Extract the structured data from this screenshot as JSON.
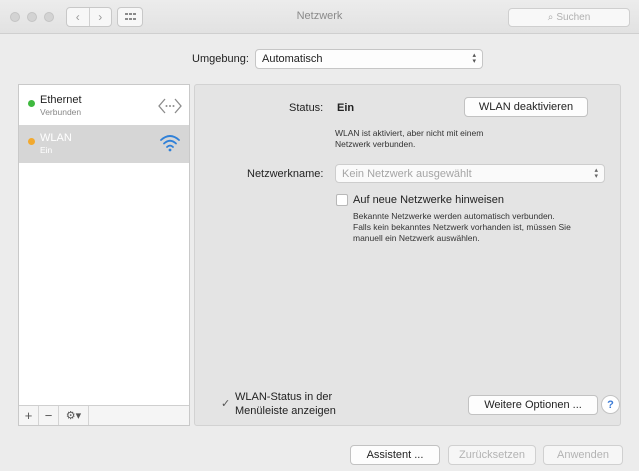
{
  "window": {
    "title": "Netzwerk",
    "search_placeholder": "Suchen",
    "back_icon": "chevron-left-icon",
    "forward_icon": "chevron-right-icon"
  },
  "location": {
    "label": "Umgebung:",
    "value": "Automatisch"
  },
  "services": [
    {
      "name": "Ethernet",
      "status": "Verbunden",
      "status_color": "#3fb93f",
      "icon": "ethernet-icon"
    },
    {
      "name": "WLAN",
      "status": "Ein",
      "status_color": "#f2a92e",
      "icon": "wifi-icon"
    }
  ],
  "sidebar_tools": {
    "add": "+",
    "remove": "−",
    "gear": "⚙▾"
  },
  "details": {
    "status_label": "Status:",
    "status_value": "Ein",
    "toggle_button": "WLAN deaktivieren",
    "status_description": [
      "WLAN ist aktiviert, aber nicht mit einem",
      "Netzwerk verbunden."
    ],
    "network_label": "Netzwerkname:",
    "network_placeholder": "Kein Netzwerk ausgewählt",
    "ask_checkbox_label": "Auf neue Netzwerke hinweisen",
    "ask_description": [
      "Bekannte Netzwerke werden automatisch verbunden.",
      "Falls kein bekanntes Netzwerk vorhanden ist, müssen Sie",
      "manuell ein Netzwerk auswählen."
    ],
    "menubar_label": [
      "WLAN-Status in der",
      "Menüleiste anzeigen"
    ],
    "advanced_button": "Weitere Optionen ...",
    "help": "?"
  },
  "footer": {
    "assistant": "Assistent ...",
    "revert": "Zurücksetzen",
    "apply": "Anwenden"
  }
}
